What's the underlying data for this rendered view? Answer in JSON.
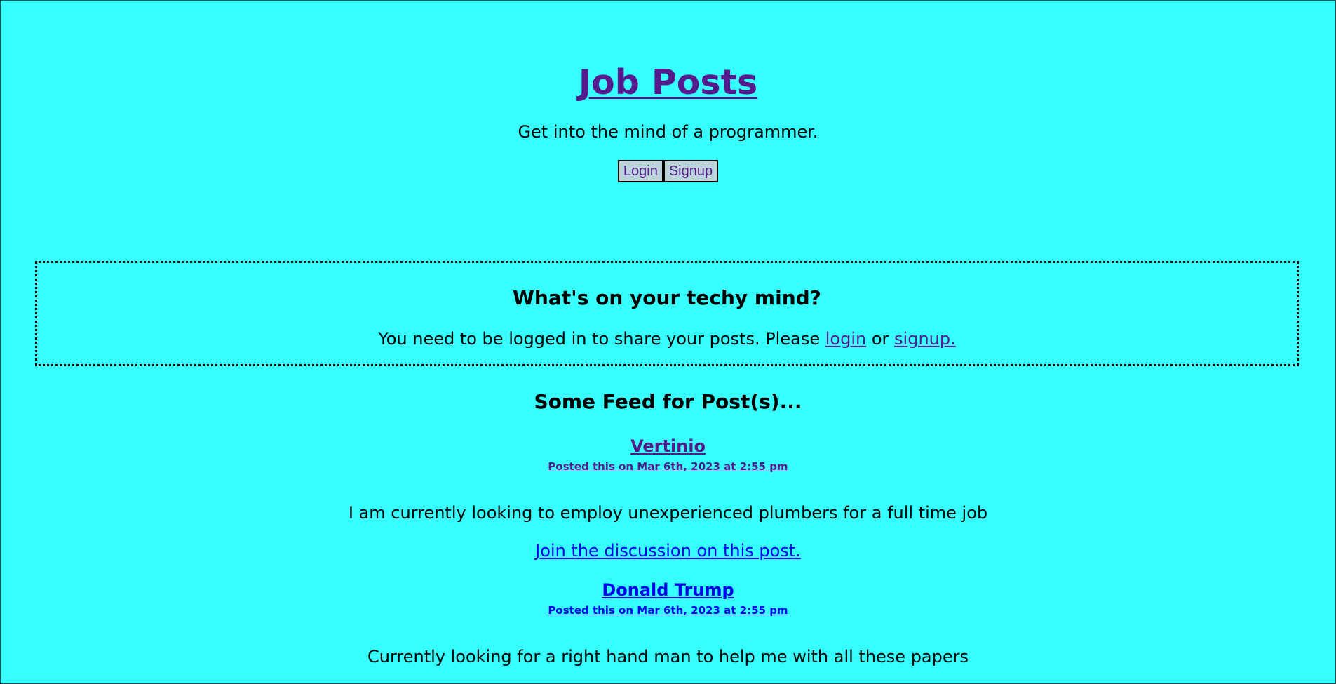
{
  "header": {
    "title": "Job Posts",
    "tagline": "Get into the mind of a programmer.",
    "login_label": "Login",
    "signup_label": "Signup"
  },
  "share": {
    "title": "What's on your techy mind?",
    "note_prefix": "You need to be logged in to share your posts. Please",
    "login_link": "login",
    "or_text": "or",
    "signup_link": "signup."
  },
  "feed": {
    "heading": "Some Feed for Post(s)...",
    "posts": [
      {
        "author": "Vertinio",
        "date": "Posted this on Mar 6th, 2023 at 2:55 pm",
        "body": "I am currently looking to employ unexperienced plumbers for a full time job",
        "discuss_label": "Join the discussion on this post."
      },
      {
        "author": "Donald Trump",
        "date": "Posted this on Mar 6th, 2023 at 2:55 pm",
        "body": "Currently looking for a right hand man to help me with all these papers"
      }
    ]
  },
  "colors": {
    "background": "#37ffff",
    "visited_link": "#551a8b",
    "link": "#0000ee",
    "button_bg": "#b9d3d9"
  }
}
